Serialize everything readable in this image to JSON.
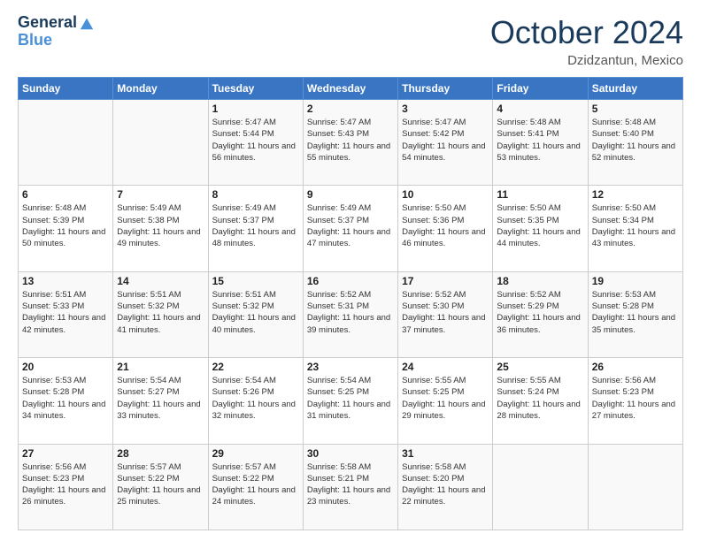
{
  "logo": {
    "line1": "General",
    "line2": "Blue"
  },
  "title": "October 2024",
  "location": "Dzidzantun, Mexico",
  "header": {
    "days": [
      "Sunday",
      "Monday",
      "Tuesday",
      "Wednesday",
      "Thursday",
      "Friday",
      "Saturday"
    ]
  },
  "weeks": [
    [
      {
        "day": "",
        "info": ""
      },
      {
        "day": "",
        "info": ""
      },
      {
        "day": "1",
        "info": "Sunrise: 5:47 AM\nSunset: 5:44 PM\nDaylight: 11 hours and 56 minutes."
      },
      {
        "day": "2",
        "info": "Sunrise: 5:47 AM\nSunset: 5:43 PM\nDaylight: 11 hours and 55 minutes."
      },
      {
        "day": "3",
        "info": "Sunrise: 5:47 AM\nSunset: 5:42 PM\nDaylight: 11 hours and 54 minutes."
      },
      {
        "day": "4",
        "info": "Sunrise: 5:48 AM\nSunset: 5:41 PM\nDaylight: 11 hours and 53 minutes."
      },
      {
        "day": "5",
        "info": "Sunrise: 5:48 AM\nSunset: 5:40 PM\nDaylight: 11 hours and 52 minutes."
      }
    ],
    [
      {
        "day": "6",
        "info": "Sunrise: 5:48 AM\nSunset: 5:39 PM\nDaylight: 11 hours and 50 minutes."
      },
      {
        "day": "7",
        "info": "Sunrise: 5:49 AM\nSunset: 5:38 PM\nDaylight: 11 hours and 49 minutes."
      },
      {
        "day": "8",
        "info": "Sunrise: 5:49 AM\nSunset: 5:37 PM\nDaylight: 11 hours and 48 minutes."
      },
      {
        "day": "9",
        "info": "Sunrise: 5:49 AM\nSunset: 5:37 PM\nDaylight: 11 hours and 47 minutes."
      },
      {
        "day": "10",
        "info": "Sunrise: 5:50 AM\nSunset: 5:36 PM\nDaylight: 11 hours and 46 minutes."
      },
      {
        "day": "11",
        "info": "Sunrise: 5:50 AM\nSunset: 5:35 PM\nDaylight: 11 hours and 44 minutes."
      },
      {
        "day": "12",
        "info": "Sunrise: 5:50 AM\nSunset: 5:34 PM\nDaylight: 11 hours and 43 minutes."
      }
    ],
    [
      {
        "day": "13",
        "info": "Sunrise: 5:51 AM\nSunset: 5:33 PM\nDaylight: 11 hours and 42 minutes."
      },
      {
        "day": "14",
        "info": "Sunrise: 5:51 AM\nSunset: 5:32 PM\nDaylight: 11 hours and 41 minutes."
      },
      {
        "day": "15",
        "info": "Sunrise: 5:51 AM\nSunset: 5:32 PM\nDaylight: 11 hours and 40 minutes."
      },
      {
        "day": "16",
        "info": "Sunrise: 5:52 AM\nSunset: 5:31 PM\nDaylight: 11 hours and 39 minutes."
      },
      {
        "day": "17",
        "info": "Sunrise: 5:52 AM\nSunset: 5:30 PM\nDaylight: 11 hours and 37 minutes."
      },
      {
        "day": "18",
        "info": "Sunrise: 5:52 AM\nSunset: 5:29 PM\nDaylight: 11 hours and 36 minutes."
      },
      {
        "day": "19",
        "info": "Sunrise: 5:53 AM\nSunset: 5:28 PM\nDaylight: 11 hours and 35 minutes."
      }
    ],
    [
      {
        "day": "20",
        "info": "Sunrise: 5:53 AM\nSunset: 5:28 PM\nDaylight: 11 hours and 34 minutes."
      },
      {
        "day": "21",
        "info": "Sunrise: 5:54 AM\nSunset: 5:27 PM\nDaylight: 11 hours and 33 minutes."
      },
      {
        "day": "22",
        "info": "Sunrise: 5:54 AM\nSunset: 5:26 PM\nDaylight: 11 hours and 32 minutes."
      },
      {
        "day": "23",
        "info": "Sunrise: 5:54 AM\nSunset: 5:25 PM\nDaylight: 11 hours and 31 minutes."
      },
      {
        "day": "24",
        "info": "Sunrise: 5:55 AM\nSunset: 5:25 PM\nDaylight: 11 hours and 29 minutes."
      },
      {
        "day": "25",
        "info": "Sunrise: 5:55 AM\nSunset: 5:24 PM\nDaylight: 11 hours and 28 minutes."
      },
      {
        "day": "26",
        "info": "Sunrise: 5:56 AM\nSunset: 5:23 PM\nDaylight: 11 hours and 27 minutes."
      }
    ],
    [
      {
        "day": "27",
        "info": "Sunrise: 5:56 AM\nSunset: 5:23 PM\nDaylight: 11 hours and 26 minutes."
      },
      {
        "day": "28",
        "info": "Sunrise: 5:57 AM\nSunset: 5:22 PM\nDaylight: 11 hours and 25 minutes."
      },
      {
        "day": "29",
        "info": "Sunrise: 5:57 AM\nSunset: 5:22 PM\nDaylight: 11 hours and 24 minutes."
      },
      {
        "day": "30",
        "info": "Sunrise: 5:58 AM\nSunset: 5:21 PM\nDaylight: 11 hours and 23 minutes."
      },
      {
        "day": "31",
        "info": "Sunrise: 5:58 AM\nSunset: 5:20 PM\nDaylight: 11 hours and 22 minutes."
      },
      {
        "day": "",
        "info": ""
      },
      {
        "day": "",
        "info": ""
      }
    ]
  ]
}
